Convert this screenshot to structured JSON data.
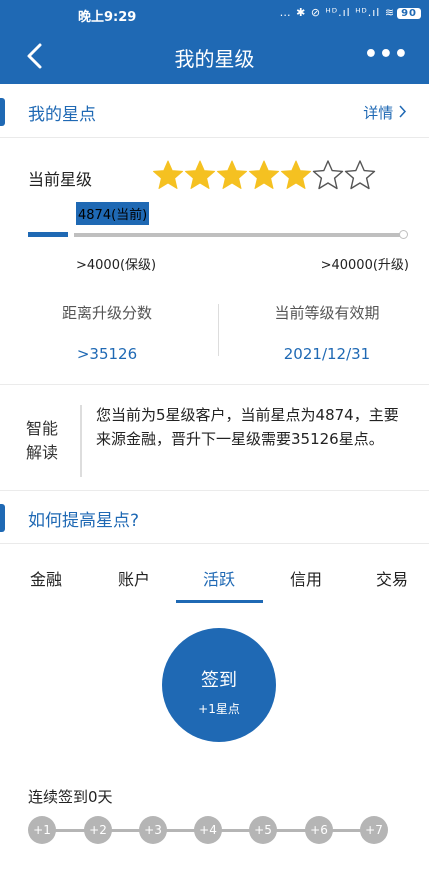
{
  "status": {
    "time": "晚上9:29",
    "indicators": "… ✱ ⊘ ᴴᴰ.ıl ᴴᴰ.ıl ≋",
    "battery": "90"
  },
  "nav": {
    "title": "我的星级",
    "more": "•••",
    "back_icon": "chevron-left-icon"
  },
  "section1": {
    "title": "我的星点",
    "detail_link": "详情"
  },
  "rating": {
    "label": "当前星级",
    "filled": 5,
    "total": 7,
    "color": "#f5c121"
  },
  "progress": {
    "current_tag": "4874(当前)",
    "min_label": ">4000(保级)",
    "max_label": ">40000(升级)",
    "fraction": 0.02
  },
  "stats": [
    {
      "label": "距离升级分数",
      "value": ">35126"
    },
    {
      "label": "当前等级有效期",
      "value": "2021/12/31"
    }
  ],
  "smart": {
    "tag": "智能解读",
    "text": "您当前为5星级客户，当前星点为4874，主要来源金融，晋升下一星级需要35126星点。"
  },
  "section2": {
    "title": "如何提高星点?"
  },
  "tabs": [
    "金融",
    "账户",
    "活跃",
    "信用",
    "交易"
  ],
  "active_tab": 2,
  "signin": {
    "label": "签到",
    "reward": "+1星点"
  },
  "streak": {
    "label": "连续签到0天",
    "days": [
      "+1",
      "+2",
      "+3",
      "+4",
      "+5",
      "+6",
      "+7"
    ]
  },
  "colors": {
    "primary": "#1f69b4",
    "gray": "#b5b5b5"
  }
}
